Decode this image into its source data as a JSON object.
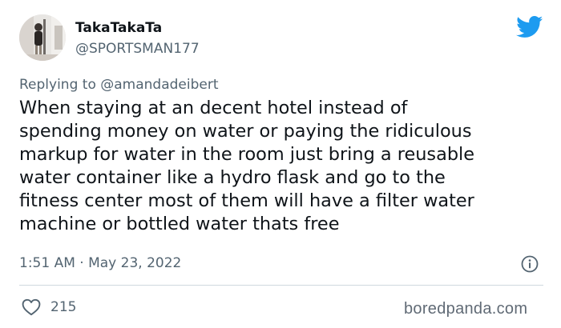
{
  "tweet": {
    "display_name": "TakaTakaTa",
    "handle": "@SPORTSMAN177",
    "reply_prefix": "Replying to ",
    "reply_to": "@amandadeibert",
    "text_lines": [
      "When staying at an decent hotel instead of",
      "spending money on water or paying the ridiculous",
      "markup for water in the room just bring a reusable",
      "water container like a hydro flask and go to the",
      "fitness center most of them will have a filter water",
      "machine or bottled water thats free"
    ],
    "timestamp": "1:51 AM · May 23, 2022",
    "like_count": "215"
  },
  "icons": {
    "brand": "twitter-bird-icon",
    "info": "info-icon",
    "like": "heart-icon"
  },
  "watermark": "boredpanda.com",
  "colors": {
    "twitter_blue": "#1d9bf0",
    "text_primary": "#0f1419",
    "text_secondary": "#536471",
    "divider": "#cfd9de"
  }
}
